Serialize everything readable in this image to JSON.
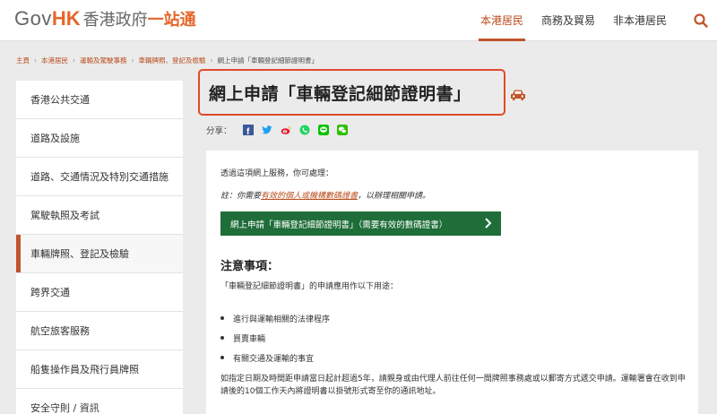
{
  "header": {
    "logo_gov": "Gov",
    "logo_hk": "HK",
    "logo_zh": "香港政府",
    "logo_zh_accent": "一站通",
    "nav": [
      {
        "label": "本港居民",
        "active": true
      },
      {
        "label": "商務及貿易",
        "active": false
      },
      {
        "label": "非本港居民",
        "active": false
      }
    ],
    "search_icon": "search-icon"
  },
  "breadcrumb": [
    "主頁",
    "本港居民",
    "運輸及駕駛事務",
    "車輛牌照、登記及檢驗",
    "網上申請「車輛登記細節證明書」"
  ],
  "sidebar": {
    "items": [
      {
        "label": "香港公共交通"
      },
      {
        "label": "道路及設施"
      },
      {
        "label": "道路、交通情況及特別交通措施"
      },
      {
        "label": "駕駛執照及考試"
      },
      {
        "label": "車輛牌照、登記及檢驗",
        "active": true
      },
      {
        "label": "跨界交通"
      },
      {
        "label": "航空旅客服務"
      },
      {
        "label": "船隻操作員及飛行員牌照"
      },
      {
        "label": "安全守則 / 資訊"
      }
    ]
  },
  "title": "網上申請「車輛登記細節證明書」",
  "share": {
    "label": "分享："
  },
  "content": {
    "intro": "透過這項網上服務，你可處理：",
    "note_prefix": "註：你需要",
    "note_link": "有效的個人或機構數碼證書",
    "note_suffix": "，以辦理相關申請。",
    "apply_button": "網上申請「車輛登記細節證明書」（需要有效的數碼證書）",
    "notes_heading": "注意事項：",
    "notes_intro": "「車輛登記細節證明書」的申請應用作以下用途：",
    "bullets": [
      "進行與運輸相關的法律程序",
      "買賣車輛",
      "有關交通及運輸的事宜"
    ],
    "paragraph": "如指定日期及時間距申請當日起計超過5年，請親身或由代理人前往任何一間牌照事務處或以郵寄方式遞交申請。運輸署會在收到申請後的10個工作天內將證明書以掛號形式寄至你的通訊地址。"
  },
  "colors": {
    "accent": "#c0542a",
    "button_green": "#1f6e3a",
    "title_border": "#e04a2a"
  }
}
